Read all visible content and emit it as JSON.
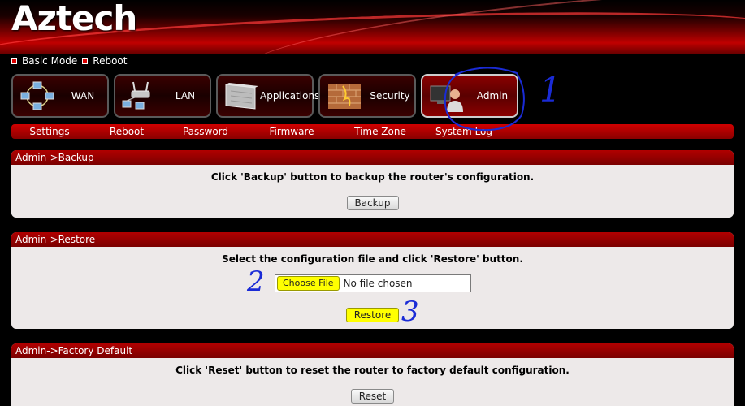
{
  "header": {
    "logo": "Aztech"
  },
  "quicklinks": [
    {
      "label": "Basic Mode"
    },
    {
      "label": "Reboot"
    }
  ],
  "tabs": [
    {
      "label": "WAN",
      "icon": "wan-network-icon"
    },
    {
      "label": "LAN",
      "icon": "lan-router-icon"
    },
    {
      "label": "Applications",
      "icon": "applications-icon"
    },
    {
      "label": "Security",
      "icon": "firewall-icon"
    },
    {
      "label": "Admin",
      "icon": "admin-user-icon",
      "active": true
    }
  ],
  "subnav": [
    "Settings",
    "Reboot",
    "Password",
    "Firmware",
    "Time Zone",
    "System Log"
  ],
  "backup": {
    "title": "Admin->Backup",
    "message": "Click 'Backup' button to backup the router's configuration.",
    "button": "Backup"
  },
  "restore": {
    "title": "Admin->Restore",
    "message": "Select the configuration file and click 'Restore' button.",
    "choose_button": "Choose File",
    "file_status": "No file chosen",
    "button": "Restore"
  },
  "factory": {
    "title": "Admin->Factory Default",
    "message": "Click 'Reset' button to reset the router to factory default configuration.",
    "button": "Reset"
  },
  "annotations": [
    "1",
    "2",
    "3"
  ],
  "colors": {
    "accent": "#c00000",
    "highlight": "#ffff00",
    "annotation": "#1a2bd6"
  }
}
